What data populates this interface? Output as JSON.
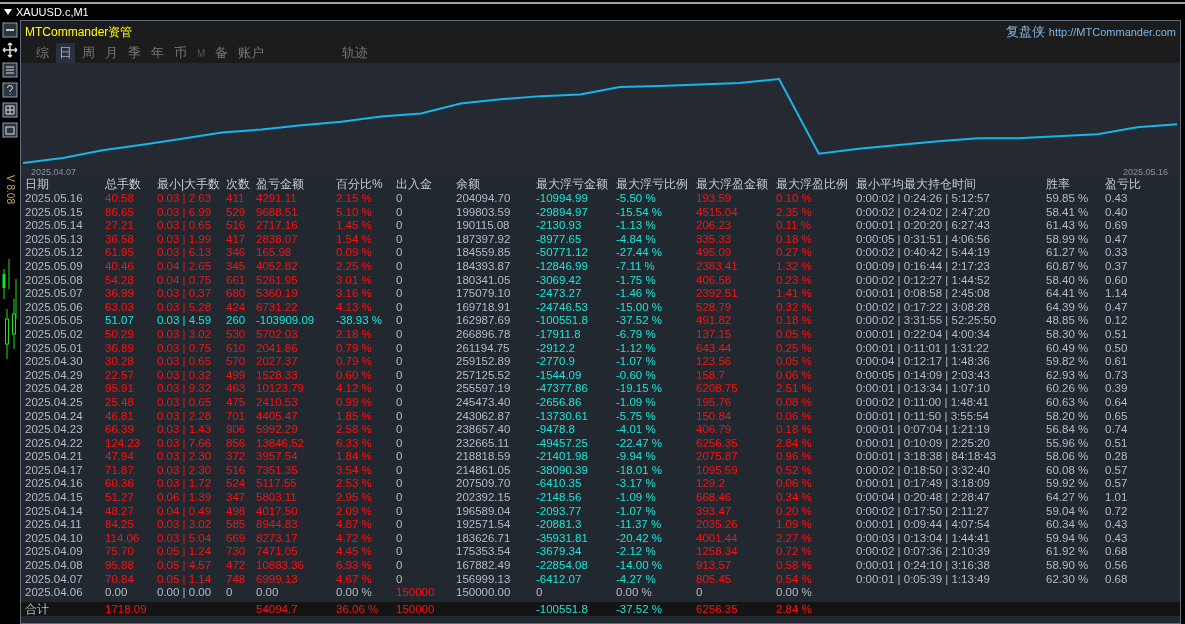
{
  "window": {
    "title": "XAUUSD.c,M1",
    "version": "V 8.08"
  },
  "panel": {
    "brand": "MTCommander资管",
    "app_name": "复盘侠",
    "url": "http://MTCommander.com"
  },
  "tabs": [
    {
      "label": "综",
      "selected": false,
      "disabled": false
    },
    {
      "label": "日",
      "selected": true,
      "disabled": false
    },
    {
      "label": "周",
      "selected": false,
      "disabled": false
    },
    {
      "label": "月",
      "selected": false,
      "disabled": false
    },
    {
      "label": "季",
      "selected": false,
      "disabled": false
    },
    {
      "label": "年",
      "selected": false,
      "disabled": false
    },
    {
      "label": "币",
      "selected": false,
      "disabled": false
    },
    {
      "label": "M",
      "selected": false,
      "disabled": true
    },
    {
      "label": "备",
      "selected": false,
      "disabled": false
    },
    {
      "label": "账户",
      "selected": false,
      "disabled": false
    },
    {
      "label": "轨迹",
      "selected": false,
      "disabled": false
    }
  ],
  "equity_chart": {
    "start_label": "2025.04.07",
    "end_label": "2025.05.16"
  },
  "table": {
    "columns": [
      "日期",
      "总手数",
      "最小|大手数",
      "次数",
      "盈亏金额",
      "百分比%",
      "出入金",
      "余额",
      "最大浮亏金额",
      "最大浮亏比例",
      "最大浮盈金额",
      "最大浮盈比例",
      "最小平均最大持仓时间",
      "胜率",
      "盈亏比"
    ],
    "rows": [
      {
        "kind": "profit",
        "cells": [
          "2025.05.16",
          "40.58",
          "0.03 | 2.63",
          "411",
          "4291.11",
          "2.15 %",
          "0",
          "204094.70",
          "-10994.99",
          "-5.50 %",
          "193.59",
          "0.10 %",
          "0:00:02 | 0:24:26 | 5:12:57",
          "59.85 %",
          "0.43"
        ]
      },
      {
        "kind": "profit",
        "cells": [
          "2025.05.15",
          "86.65",
          "0.03 | 6.99",
          "529",
          "9688.51",
          "5.10 %",
          "0",
          "199803.59",
          "-29894.97",
          "-15.54 %",
          "4515.04",
          "2.35 %",
          "0:00:02 | 0:24:02 | 2:47:20",
          "58.41 %",
          "0.40"
        ]
      },
      {
        "kind": "profit",
        "cells": [
          "2025.05.14",
          "27.21",
          "0.03 | 0.65",
          "516",
          "2717.16",
          "1.45 %",
          "0",
          "190115.08",
          "-2130.93",
          "-1.13 %",
          "206.23",
          "0.11 %",
          "0:00:01 | 0:20:20 | 6:27:43",
          "61.43 %",
          "0.69"
        ]
      },
      {
        "kind": "profit",
        "cells": [
          "2025.05.13",
          "36.58",
          "0.03 | 1.99",
          "417",
          "2838.07",
          "1.54 %",
          "0",
          "187397.92",
          "-8977.65",
          "-4.84 %",
          "335.33",
          "0.18 %",
          "0:00:05 | 0:31:51 | 4:06:56",
          "58.99 %",
          "0.47"
        ]
      },
      {
        "kind": "profit",
        "cells": [
          "2025.05.12",
          "61.95",
          "0.03 | 6.13",
          "346",
          "165.98",
          "0.09 %",
          "0",
          "184559.85",
          "-50771.12",
          "-27.44 %",
          "495.09",
          "0.27 %",
          "0:00:02 | 0:40:42 | 5:44:19",
          "61.27 %",
          "0.33"
        ]
      },
      {
        "kind": "profit",
        "cells": [
          "2025.05.09",
          "40.46",
          "0.04 | 2.65",
          "345",
          "4052.82",
          "2.25 %",
          "0",
          "184393.87",
          "-12846.99",
          "-7.11 %",
          "2383.41",
          "1.32 %",
          "0:00:09 | 0:16:44 | 2:17:23",
          "60.87 %",
          "0.37"
        ]
      },
      {
        "kind": "profit",
        "cells": [
          "2025.05.08",
          "54.28",
          "0.04 | 0.75",
          "661",
          "5261.95",
          "3.01 %",
          "0",
          "180341.05",
          "-3069.42",
          "-1.75 %",
          "406.58",
          "0.23 %",
          "0:00:02 | 0:12:27 | 1:44:52",
          "58.40 %",
          "0.60"
        ]
      },
      {
        "kind": "profit",
        "cells": [
          "2025.05.07",
          "36.99",
          "0.03 | 0.37",
          "680",
          "5360.19",
          "3.16 %",
          "0",
          "175079.10",
          "-2473.27",
          "-1.46 %",
          "2392.51",
          "1.41 %",
          "0:00:01 | 0:08:58 | 2:45:08",
          "64.41 %",
          "1.14"
        ]
      },
      {
        "kind": "profit",
        "cells": [
          "2025.05.06",
          "63.03",
          "0.03 | 5.28",
          "424",
          "6731.22",
          "4.13 %",
          "0",
          "169718.91",
          "-24746.53",
          "-15.00 %",
          "528.79",
          "0.32 %",
          "0:00:02 | 0:17:22 | 3:08:28",
          "64.39 %",
          "0.47"
        ]
      },
      {
        "kind": "loss",
        "cells": [
          "2025.05.05",
          "51.07",
          "0.03 | 4.59",
          "260",
          "-103909.09",
          "-38.93 %",
          "0",
          "162987.69",
          "-100551.8",
          "-37.52 %",
          "491.82",
          "0.18 %",
          "0:00:02 | 3:31:55 | 52:25:50",
          "48.85 %",
          "0.12"
        ]
      },
      {
        "kind": "profit",
        "cells": [
          "2025.05.02",
          "50.29",
          "0.03 | 3.02",
          "530",
          "5702.03",
          "2.18 %",
          "0",
          "266896.78",
          "-17911.8",
          "-6.79 %",
          "137.15",
          "0.05 %",
          "0:00:01 | 0:22:04 | 4:00:34",
          "58.30 %",
          "0.51"
        ]
      },
      {
        "kind": "profit",
        "cells": [
          "2025.05.01",
          "36.89",
          "0.03 | 0.75",
          "610",
          "2041.86",
          "0.79 %",
          "0",
          "261194.75",
          "-2912.2",
          "-1.12 %",
          "643.44",
          "0.25 %",
          "0:00:01 | 0:11:01 | 1:31:22",
          "60.49 %",
          "0.50"
        ]
      },
      {
        "kind": "profit",
        "cells": [
          "2025.04.30",
          "30.28",
          "0.03 | 0.65",
          "570",
          "2027.37",
          "0.79 %",
          "0",
          "259152.89",
          "-2770.9",
          "-1.07 %",
          "123.56",
          "0.05 %",
          "0:00:04 | 0:12:17 | 1:48:36",
          "59.82 %",
          "0.61"
        ]
      },
      {
        "kind": "profit",
        "cells": [
          "2025.04.29",
          "22.57",
          "0.03 | 0.32",
          "499",
          "1528.33",
          "0.60 %",
          "0",
          "257125.52",
          "-1544.09",
          "-0.60 %",
          "158.7",
          "0.06 %",
          "0:00:05 | 0:14:09 | 2:03:43",
          "62.93 %",
          "0.73"
        ]
      },
      {
        "kind": "profit",
        "cells": [
          "2025.04.28",
          "95.91",
          "0.03 | 9.32",
          "463",
          "10123.79",
          "4.12 %",
          "0",
          "255597.19",
          "-47377.86",
          "-19.15 %",
          "6208.75",
          "2.51 %",
          "0:00:01 | 0:13:34 | 1:07:10",
          "60.26 %",
          "0.39"
        ]
      },
      {
        "kind": "profit",
        "cells": [
          "2025.04.25",
          "25.48",
          "0.03 | 0.65",
          "475",
          "2410.53",
          "0.99 %",
          "0",
          "245473.40",
          "-2656.86",
          "-1.09 %",
          "195.76",
          "0.08 %",
          "0:00:02 | 0:11:00 | 1:48:41",
          "60.63 %",
          "0.64"
        ]
      },
      {
        "kind": "profit",
        "cells": [
          "2025.04.24",
          "46.81",
          "0.03 | 2.28",
          "701",
          "4405.47",
          "1.85 %",
          "0",
          "243062.87",
          "-13730.61",
          "-5.75 %",
          "150.84",
          "0.06 %",
          "0:00:01 | 0:11:50 | 3:55:54",
          "58.20 %",
          "0.65"
        ]
      },
      {
        "kind": "profit",
        "cells": [
          "2025.04.23",
          "66.39",
          "0.03 | 1.43",
          "906",
          "5992.29",
          "2.58 %",
          "0",
          "238657.40",
          "-9478.8",
          "-4.01 %",
          "406.79",
          "0.18 %",
          "0:00:01 | 0:07:04 | 1:21:19",
          "56.84 %",
          "0.74"
        ]
      },
      {
        "kind": "profit",
        "cells": [
          "2025.04.22",
          "124.23",
          "0.03 | 7.66",
          "856",
          "13846.52",
          "6.33 %",
          "0",
          "232665.11",
          "-49457.25",
          "-22.47 %",
          "6256.35",
          "2.84 %",
          "0:00:01 | 0:10:09 | 2:25:20",
          "55.96 %",
          "0.51"
        ]
      },
      {
        "kind": "profit",
        "cells": [
          "2025.04.21",
          "47.94",
          "0.03 | 2.30",
          "372",
          "3957.54",
          "1.84 %",
          "0",
          "218818.59",
          "-21401.98",
          "-9.94 %",
          "2075.87",
          "0.96 %",
          "0:00:01 | 3:18:38 | 84:18:43",
          "58.06 %",
          "0.28"
        ]
      },
      {
        "kind": "profit",
        "cells": [
          "2025.04.17",
          "71.87",
          "0.03 | 2.30",
          "516",
          "7351.35",
          "3.54 %",
          "0",
          "214861.05",
          "-38090.39",
          "-18.01 %",
          "1095.59",
          "0.52 %",
          "0:00:02 | 0:18:50 | 3:32:40",
          "60.08 %",
          "0.57"
        ]
      },
      {
        "kind": "profit",
        "cells": [
          "2025.04.16",
          "60.36",
          "0.03 | 1.72",
          "524",
          "5117.55",
          "2.53 %",
          "0",
          "207509.70",
          "-6410.35",
          "-3.17 %",
          "129.2",
          "0.06 %",
          "0:00:01 | 0:17:49 | 3:18:09",
          "59.92 %",
          "0.57"
        ]
      },
      {
        "kind": "profit",
        "cells": [
          "2025.04.15",
          "51.27",
          "0.06 | 1.39",
          "347",
          "5803.11",
          "2.95 %",
          "0",
          "202392.15",
          "-2148.56",
          "-1.09 %",
          "668.46",
          "0.34 %",
          "0:00:04 | 0:20:48 | 2:28:47",
          "64.27 %",
          "1.01"
        ]
      },
      {
        "kind": "profit",
        "cells": [
          "2025.04.14",
          "48.27",
          "0.04 | 0.49",
          "498",
          "4017.50",
          "2.09 %",
          "0",
          "196589.04",
          "-2093.77",
          "-1.07 %",
          "393.47",
          "0.20 %",
          "0:00:02 | 0:17:50 | 2:11:27",
          "59.04 %",
          "0.72"
        ]
      },
      {
        "kind": "profit",
        "cells": [
          "2025.04.11",
          "84.25",
          "0.03 | 3.02",
          "585",
          "8944.83",
          "4.87 %",
          "0",
          "192571.54",
          "-20881.3",
          "-11.37 %",
          "2035.26",
          "1.09 %",
          "0:00:01 | 0:09:44 | 4:07:54",
          "60.34 %",
          "0.43"
        ]
      },
      {
        "kind": "profit",
        "cells": [
          "2025.04.10",
          "114.06",
          "0.03 | 5.04",
          "669",
          "8273.17",
          "4.72 %",
          "0",
          "183626.71",
          "-35931.81",
          "-20.42 %",
          "4001.44",
          "2.27 %",
          "0:00:03 | 0:13:04 | 1:44:41",
          "59.94 %",
          "0.43"
        ]
      },
      {
        "kind": "profit",
        "cells": [
          "2025.04.09",
          "75.70",
          "0.05 | 1.24",
          "730",
          "7471.05",
          "4.45 %",
          "0",
          "175353.54",
          "-3679.34",
          "-2.12 %",
          "1258.34",
          "0.72 %",
          "0:00:02 | 0:07:36 | 2:10:39",
          "61.92 %",
          "0.68"
        ]
      },
      {
        "kind": "profit",
        "cells": [
          "2025.04.08",
          "95.88",
          "0.05 | 4.57",
          "472",
          "10883.36",
          "6.93 %",
          "0",
          "167882.49",
          "-22854.08",
          "-14.00 %",
          "913.57",
          "0.58 %",
          "0:00:01 | 0:24:10 | 3:16:38",
          "58.90 %",
          "0.56"
        ]
      },
      {
        "kind": "profit",
        "cells": [
          "2025.04.07",
          "70.84",
          "0.05 | 1.14",
          "748",
          "6999.13",
          "4.67 %",
          "0",
          "156999.13",
          "-6412.07",
          "-4.27 %",
          "805.45",
          "0.54 %",
          "0:00:01 | 0:05:39 | 1:13:49",
          "62.30 %",
          "0.68"
        ]
      },
      {
        "kind": "flat",
        "cells": [
          "2025.04.06",
          "0.00",
          "0.00 | 0.00",
          "0",
          "0.00",
          "0.00 %",
          "150000",
          "150000.00",
          "0",
          "0.00 %",
          "0",
          "0.00 %"
        ]
      }
    ],
    "total": {
      "label": "合计",
      "lots": "1718.09",
      "pnl": "54094.7",
      "pct": "36.06 %",
      "deposit": "150000",
      "max_float_loss": "-100551.8",
      "max_float_loss_pct": "-37.52 %",
      "max_float_profit": "6256.35",
      "max_float_profit_pct": "2.84 %"
    }
  }
}
